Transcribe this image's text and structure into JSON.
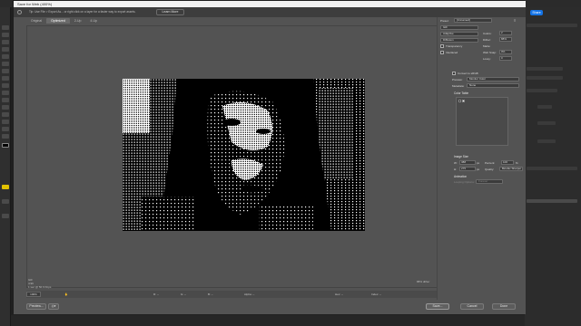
{
  "dialog": {
    "title": "Save for Web (400%)",
    "tip": "Tip: Use File > Export As... or right click on a layer for a faster way to export assets.",
    "learn_more_label": "Learn More"
  },
  "tabs": [
    "Original",
    "Optimized",
    "2-Up",
    "4-Up"
  ],
  "share_label": "Share",
  "settings": {
    "preset_label": "Preset:",
    "preset_value": "[Unnamed]",
    "format_value": "GIF",
    "reduction_value": "Adaptive",
    "colors_label": "Colors:",
    "colors_value": "2",
    "dither_value": "Diffusion",
    "dither_label": "Dither:",
    "dither_amount": "88%",
    "transparency_label": "Transparency",
    "matte_label": "Matte:",
    "interlaced_label": "Interlaced",
    "web_snap_label": "Web Snap:",
    "web_snap_value": "0%",
    "lossy_label": "Lossy:",
    "lossy_value": "0",
    "convert_srgb_label": "Convert to sRGB",
    "preview_label": "Preview:",
    "preview_value": "Monitor Color",
    "metadata_label": "Metadata:",
    "metadata_value": "None",
    "color_table_label": "Color Table",
    "image_size_label": "Image Size",
    "width_label": "W:",
    "width_value": "388",
    "height_label": "H:",
    "height_value": "275",
    "unit_px": "px",
    "percent_label": "Percent:",
    "percent_value": "100",
    "percent_unit": "%",
    "quality_label": "Quality:",
    "quality_value": "Bicubic Sharper",
    "animation_label": "Animation",
    "looping_label": "Looping Options:",
    "looping_value": "Forever"
  },
  "preview_info": {
    "line1": "GIF",
    "line2": "4.9K",
    "line3": "1 sec @ 56.6 Kbps",
    "right": "88% dither"
  },
  "status_bar": {
    "zoom": "100%",
    "r": "R: --",
    "g": "G: --",
    "b": "B: --",
    "alpha": "Alpha: --",
    "hex": "Hex: --",
    "index": "Index: --"
  },
  "footer": {
    "preview_button": "Preview...",
    "save_button": "Save...",
    "cancel_button": "Cancel",
    "done_button": "Done"
  },
  "colors": {
    "accent": "#1473e6",
    "dialog_bg": "#535353",
    "title_bar": "#f2f2f2"
  }
}
